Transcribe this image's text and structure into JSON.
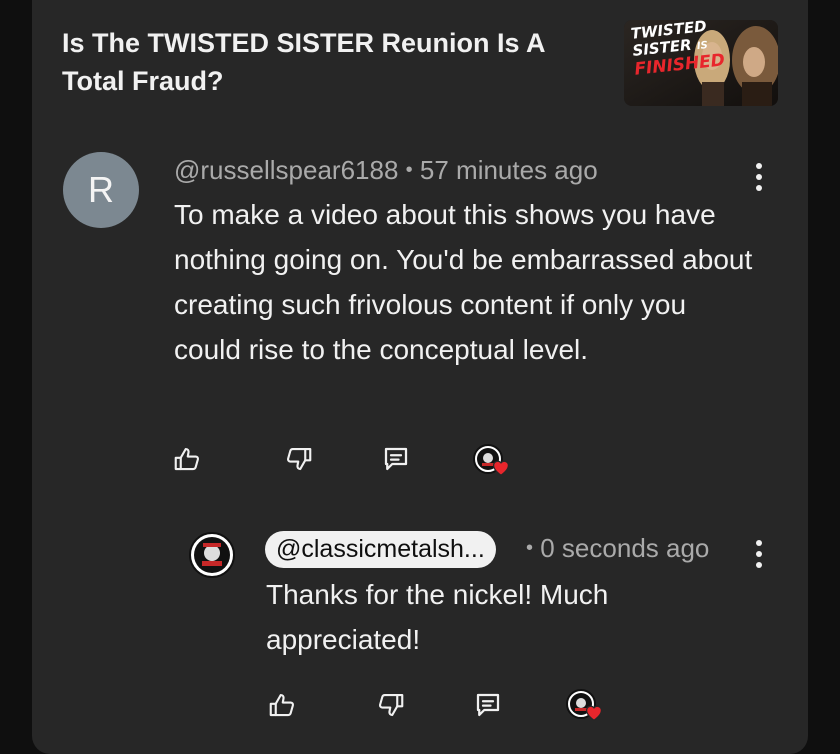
{
  "video": {
    "title": "Is The TWISTED SISTER Reunion Is A Total Fraud?",
    "thumbnail_text": {
      "line1": "TWISTED",
      "line2": "SISTER",
      "line2_small": "IS",
      "line3": "FINISHED"
    }
  },
  "comment": {
    "avatar_letter": "R",
    "author": "@russellspear6188",
    "separator": "•",
    "time": "57 minutes ago",
    "text": "To make a video about this shows you have nothing going on. You'd be embarrassed about creating such frivolous content if only you could rise to the conceptual level."
  },
  "reply": {
    "author": "@classicmetalsh...",
    "separator": "•",
    "time": "0 seconds ago",
    "text": "Thanks for the nickel! Much appreciated!"
  },
  "icons": {
    "like": "thumbs-up-icon",
    "dislike": "thumbs-down-icon",
    "reply": "reply-icon",
    "creator_heart": "creator-heart-icon",
    "more": "more-vert-icon"
  },
  "colors": {
    "background": "#0f0f0f",
    "panel": "#272727",
    "text": "#f1f1f1",
    "muted": "#aaaaaa",
    "avatar": "#7c8891",
    "heart": "#e8262c"
  }
}
